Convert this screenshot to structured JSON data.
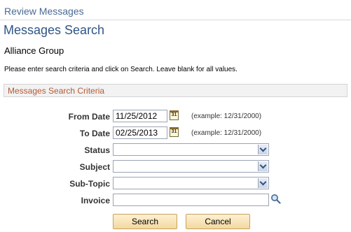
{
  "breadcrumb": "Review Messages",
  "page_title": "Messages Search",
  "org_name": "Alliance Group",
  "instructions": "Please enter search criteria and click on Search. Leave blank for all values.",
  "section_title": "Messages Search Criteria",
  "form": {
    "from_date": {
      "label": "From Date",
      "value": "11/25/2012",
      "example": "(example: 12/31/2000)"
    },
    "to_date": {
      "label": "To Date",
      "value": "02/25/2013",
      "example": "(example: 12/31/2000)"
    },
    "status": {
      "label": "Status",
      "value": ""
    },
    "subject": {
      "label": "Subject",
      "value": ""
    },
    "sub_topic": {
      "label": "Sub-Topic",
      "value": ""
    },
    "invoice": {
      "label": "Invoice",
      "value": ""
    }
  },
  "buttons": {
    "search": "Search",
    "cancel": "Cancel"
  },
  "icons": {
    "calendar": "calendar-icon",
    "lookup": "magnifier-icon",
    "dropdown": "chevron-down-icon"
  }
}
